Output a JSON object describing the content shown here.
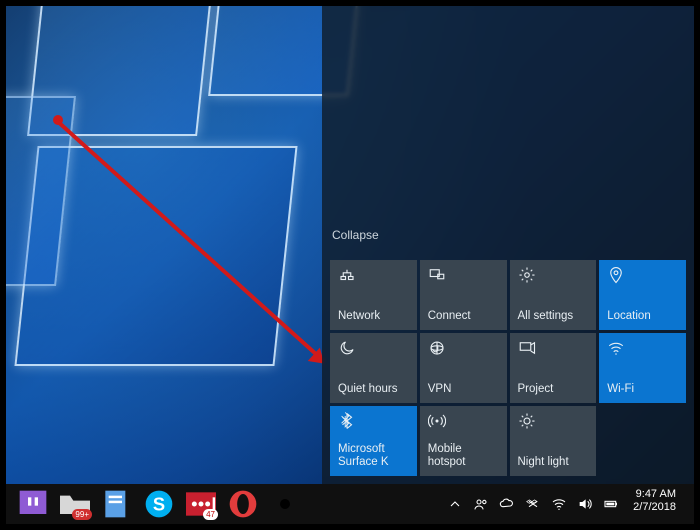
{
  "action_center": {
    "collapse_label": "Collapse",
    "tiles": [
      {
        "id": "network",
        "label": "Network",
        "icon": "network-icon",
        "active": false
      },
      {
        "id": "connect",
        "label": "Connect",
        "icon": "connect-icon",
        "active": false
      },
      {
        "id": "all-settings",
        "label": "All settings",
        "icon": "gear-icon",
        "active": false
      },
      {
        "id": "location",
        "label": "Location",
        "icon": "location-icon",
        "active": true
      },
      {
        "id": "quiet-hours",
        "label": "Quiet hours",
        "icon": "moon-icon",
        "active": false
      },
      {
        "id": "vpn",
        "label": "VPN",
        "icon": "vpn-icon",
        "active": false
      },
      {
        "id": "project",
        "label": "Project",
        "icon": "project-icon",
        "active": false
      },
      {
        "id": "wifi",
        "label": "Wi-Fi",
        "icon": "wifi-icon",
        "active": true
      },
      {
        "id": "bluetooth",
        "label": "Microsoft Surface K",
        "icon": "bluetooth-icon",
        "active": true
      },
      {
        "id": "mobile-hotspot",
        "label": "Mobile hotspot",
        "icon": "hotspot-icon",
        "active": false
      },
      {
        "id": "night-light",
        "label": "Night light",
        "icon": "sun-icon",
        "active": false
      }
    ]
  },
  "taskbar": {
    "items": [
      {
        "id": "twitch",
        "badge": ""
      },
      {
        "id": "mail",
        "badge": "99+"
      },
      {
        "id": "pad",
        "badge": ""
      },
      {
        "id": "skype",
        "badge": ""
      },
      {
        "id": "lastpass",
        "badge": "47"
      },
      {
        "id": "opera",
        "badge": ""
      },
      {
        "id": "settings",
        "badge": ""
      }
    ]
  },
  "tray": {
    "time": "9:47 AM",
    "date": "2/7/2018"
  }
}
